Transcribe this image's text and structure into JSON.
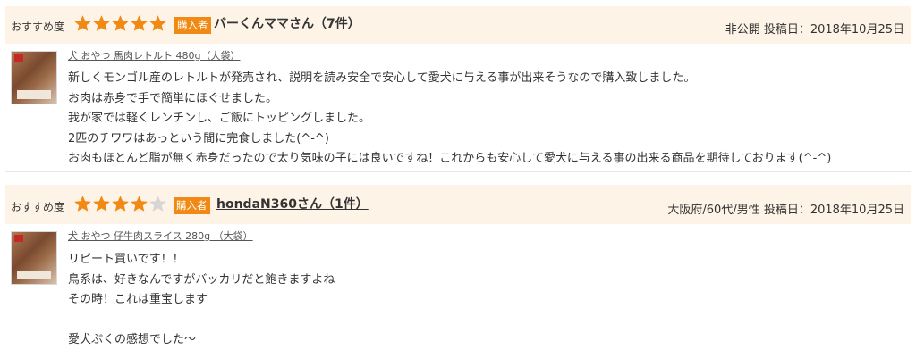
{
  "colors": {
    "header_bg": "#fdf3e6",
    "star_filled": "#f08a14",
    "star_empty": "#d6d6d6",
    "badge_bg": "#f08a14",
    "divider": "#f2cc8f"
  },
  "reviews": [
    {
      "recommend_label": "おすすめ度",
      "rating": 5,
      "rating_max": 5,
      "badge": "購入者",
      "user": "バーくんママさん（7件）",
      "meta": "非公開 投稿日：2018年10月25日",
      "product": "犬 おやつ 馬肉レトルト 480g（大袋）",
      "thumbnail_icon": "product-thumbnail-horse-meat",
      "lines": [
        "新しくモンゴル産のレトルトが発売され、説明を読み安全で安心して愛犬に与える事が出来そうなので購入致しました。",
        "お肉は赤身で手で簡単にほぐせました。",
        "我が家では軽くレンチンし、ご飯にトッピングしました。",
        "2匹のチワワはあっという間に完食しました(^-^)",
        "お肉もほとんど脂が無く赤身だったので太り気味の子には良いですね！これからも安心して愛犬に与える事の出来る商品を期待しております(^-^)"
      ]
    },
    {
      "recommend_label": "おすすめ度",
      "rating": 4,
      "rating_max": 5,
      "badge": "購入者",
      "user": "hondaN360さん（1件）",
      "meta": "大阪府/60代/男性 投稿日：2018年10月25日",
      "product": "犬 おやつ 仔牛肉スライス 280g （大袋）",
      "thumbnail_icon": "product-thumbnail-veal-slice",
      "lines": [
        "リピート買いです！！",
        "鳥系は、好きなんですがバッカリだと飽きますよね",
        "その時！これは重宝します",
        "",
        "愛犬ぷくの感想でした～"
      ]
    }
  ]
}
